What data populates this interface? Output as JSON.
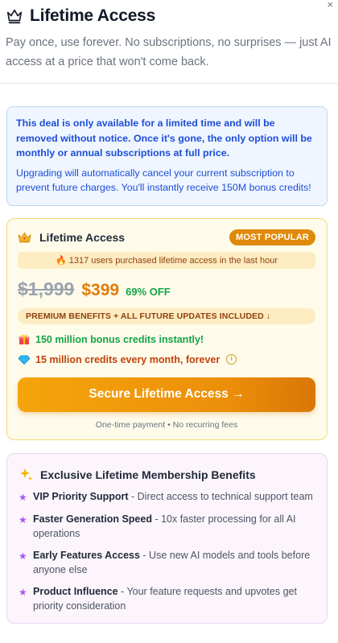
{
  "dialog": {
    "close_label": "×"
  },
  "header": {
    "title": "Lifetime Access",
    "subtitle": "Pay once, use forever. No subscriptions, no surprises — just AI access at a price that won't come back."
  },
  "notice": {
    "warning": "This deal is only available for a limited time and will be removed without notice. Once it's gone, the only option will be monthly or annual subscriptions at full price.",
    "info": "Upgrading will automatically cancel your current subscription to prevent future charges. You'll instantly receive 150M bonus credits!"
  },
  "offer": {
    "title": "Lifetime Access",
    "badge": "MOST POPULAR",
    "purchased": "🔥 1317 users purchased lifetime access in the last hour",
    "old_price": "$1,999",
    "new_price": "$399",
    "discount": "69% OFF",
    "benefits_pill": "PREMIUM BENEFITS + ALL FUTURE UPDATES INCLUDED ↓",
    "perk_bonus": "150 million bonus credits instantly!",
    "perk_monthly": "15 million credits every month, forever",
    "cta": "Secure Lifetime Access →",
    "note": "One-time payment • No recurring fees"
  },
  "members": {
    "title": "Exclusive Lifetime Membership Benefits",
    "items": [
      {
        "name": "VIP Priority Support",
        "desc": " - Direct access to technical support team"
      },
      {
        "name": "Faster Generation Speed",
        "desc": " - 10x faster processing for all AI operations"
      },
      {
        "name": "Early Features Access",
        "desc": " - Use new AI models and tools before anyone else"
      },
      {
        "name": "Product Influence",
        "desc": " - Your feature requests and upvotes get priority consideration"
      }
    ]
  },
  "icons": {
    "crown": "crown-icon",
    "gift": "gift-icon",
    "diamond": "diamond-icon",
    "info": "info-icon",
    "sparkle": "sparkle-icon",
    "star": "star-icon"
  },
  "colors": {
    "accent_orange": "#e08a0b",
    "notice_blue": "#1d4ed8",
    "success_green": "#16a34a",
    "purple_star": "#a855f7"
  }
}
